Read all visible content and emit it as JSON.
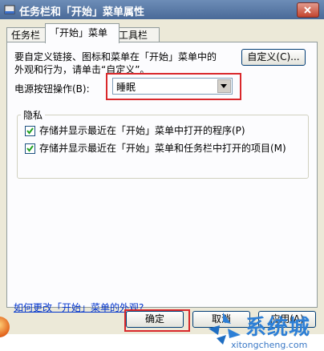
{
  "window": {
    "title": "任务栏和「开始」菜单属性"
  },
  "tabs": [
    {
      "label": "任务栏"
    },
    {
      "label": "「开始」菜单"
    },
    {
      "label": "工具栏"
    }
  ],
  "start_menu": {
    "description_line1": "要自定义链接、图标和菜单在「开始」菜单中的",
    "description_line2": "外观和行为，请单击“自定义”。",
    "customize_label": "自定义(C)...",
    "power_label": "电源按钮操作(B):",
    "power_value": "睡眠",
    "privacy_title": "隐私",
    "privacy_items": [
      {
        "label": "存储并显示最近在「开始」菜单中打开的程序(P)",
        "checked": true
      },
      {
        "label": "存储并显示最近在「开始」菜单和任务栏中打开的项目(M)",
        "checked": true
      }
    ],
    "help_link": "如何更改「开始」菜单的外观?"
  },
  "footer": {
    "ok_label": "确定",
    "cancel_label": "取消",
    "apply_label": "应用(A)"
  },
  "watermark": {
    "text": "系统城",
    "domain": "xitongcheng.com"
  },
  "colors": {
    "title_bar": "#4a6a98",
    "highlight_box": "#d9282b",
    "link": "#0033cc",
    "watermark": "#2d7fd6"
  }
}
